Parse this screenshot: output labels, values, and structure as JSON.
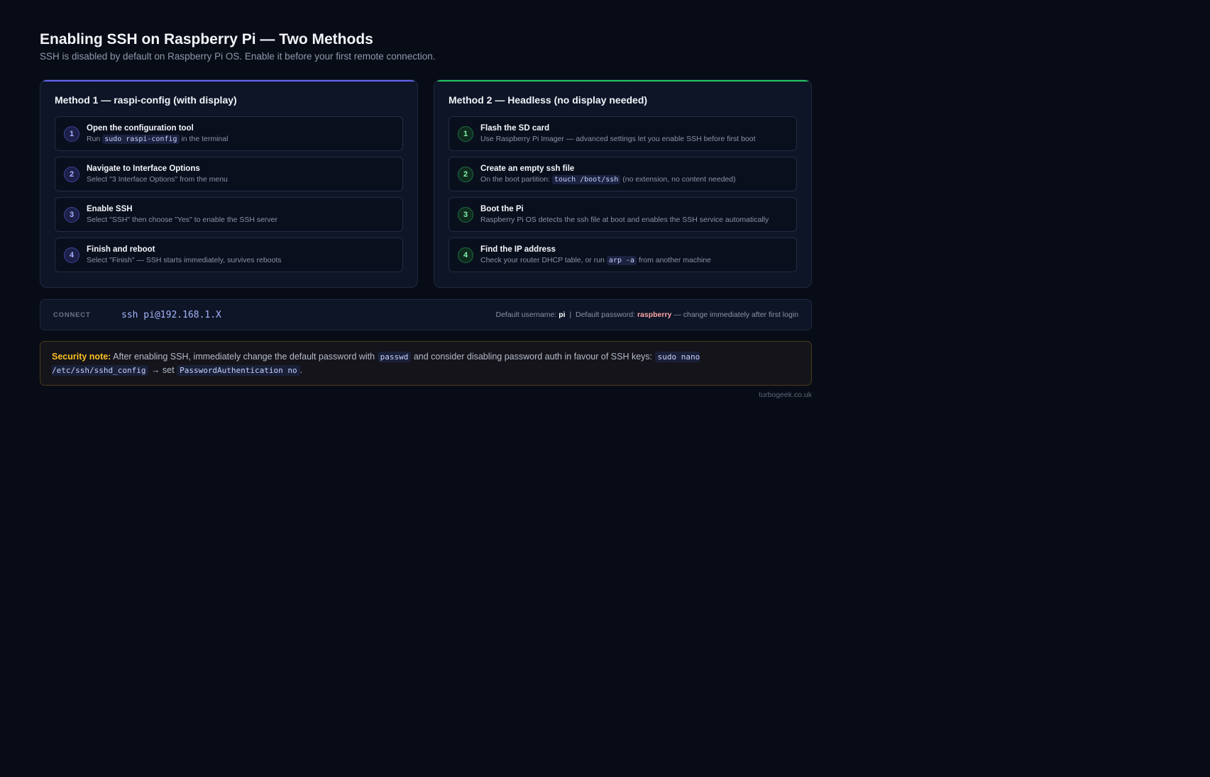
{
  "header": {
    "title": "Enabling SSH on Raspberry Pi — Two Methods",
    "subtitle": "SSH is disabled by default on Raspberry Pi OS. Enable it before your first remote connection."
  },
  "method1": {
    "title": "Method 1 — raspi-config (with display)",
    "accent": "#6366f1",
    "steps": [
      {
        "num": "1",
        "title": "Open the configuration tool",
        "pre": "Run",
        "code": "sudo raspi-config",
        "post": "in the terminal"
      },
      {
        "num": "2",
        "title": "Navigate to Interface Options",
        "desc": "Select \"3 Interface Options\" from the menu"
      },
      {
        "num": "3",
        "title": "Enable SSH",
        "desc": "Select \"SSH\" then choose \"Yes\" to enable the SSH server"
      },
      {
        "num": "4",
        "title": "Finish and reboot",
        "desc": "Select \"Finish\" — SSH starts immediately, survives reboots"
      }
    ]
  },
  "method2": {
    "title": "Method 2 — Headless (no display needed)",
    "accent": "#22c55e",
    "steps": [
      {
        "num": "1",
        "title": "Flash the SD card",
        "desc": "Use Raspberry Pi Imager — advanced settings let you enable SSH before first boot"
      },
      {
        "num": "2",
        "title": "Create an empty ssh file",
        "pre": "On the boot partition:",
        "code": "touch /boot/ssh",
        "post": "(no extension, no content needed)"
      },
      {
        "num": "3",
        "title": "Boot the Pi",
        "desc": "Raspberry Pi OS detects the ssh file at boot and enables the SSH service automatically"
      },
      {
        "num": "4",
        "title": "Find the IP address",
        "pre": "Check your router DHCP table, or run",
        "code": "arp -a",
        "post": "from another machine"
      }
    ]
  },
  "connect": {
    "label": "CONNECT",
    "command": "ssh pi@192.168.1.X",
    "user_label": "Default username:",
    "user": "pi",
    "separator": "|",
    "pw_label": "Default password:",
    "password": "raspberry",
    "pw_note": "— change immediately after first login"
  },
  "security": {
    "label": "Security note:",
    "text1": "After enabling SSH, immediately change the default password with",
    "code1": "passwd",
    "text2": "and consider disabling password auth in favour of SSH keys:",
    "code2": "sudo nano /etc/ssh/sshd_config",
    "text3": "→ set",
    "code3": "PasswordAuthentication no",
    "text4": "."
  },
  "footer": {
    "site": "turbogeek.co.uk"
  },
  "colors": {
    "background": "#080c17",
    "method1_accent": "#6366f1",
    "method2_accent": "#22c55e",
    "warning": "#fbbf24",
    "password": "#fca5a5"
  }
}
